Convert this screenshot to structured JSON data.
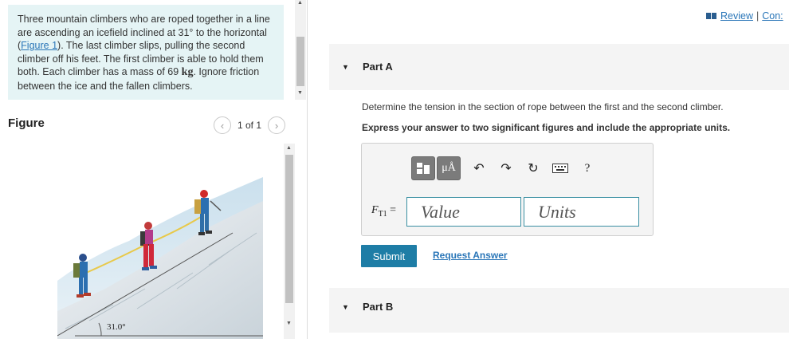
{
  "problem": {
    "text_before_link": "Three mountain climbers who are roped together in a line are ascending an icefield inclined at 31° to the horizontal (",
    "link": "Figure 1",
    "text_after_link": "). The last climber slips, pulling the second climber off his feet. The first climber is able to hold them both. Each climber has a mass of 69 ",
    "mass_unit": "kg",
    "text_end": ". Ignore friction between the ice and the fallen climbers."
  },
  "figure": {
    "header": "Figure",
    "pager_text": "1 of 1",
    "prev_icon": "chevron-left-icon",
    "next_icon": "chevron-right-icon",
    "angle_label": "31.0°"
  },
  "review": {
    "review_label": "Review",
    "separator": "|",
    "constants_label": "Con:"
  },
  "part_a": {
    "label": "Part A",
    "question": "Determine the tension in the section of rope between the first and the second climber.",
    "instruction": "Express your answer to two significant figures and include the appropriate units.",
    "variable": "F",
    "variable_sub": "T1",
    "equals": " =",
    "value_placeholder": "Value",
    "units_placeholder": "Units",
    "toolbar": {
      "template_icon": "template-icon",
      "mu_label": "μÅ",
      "undo_icon": "undo-icon",
      "redo_icon": "redo-icon",
      "reset_icon": "reset-icon",
      "keyboard_icon": "keyboard-icon",
      "help_label": "?"
    },
    "submit_label": "Submit",
    "request_label": "Request Answer"
  },
  "part_b": {
    "label": "Part B"
  },
  "colors": {
    "problem_bg": "#e5f4f5",
    "link": "#2a76b8",
    "submit_bg": "#1e7da6",
    "input_border": "#3a8fa2"
  }
}
